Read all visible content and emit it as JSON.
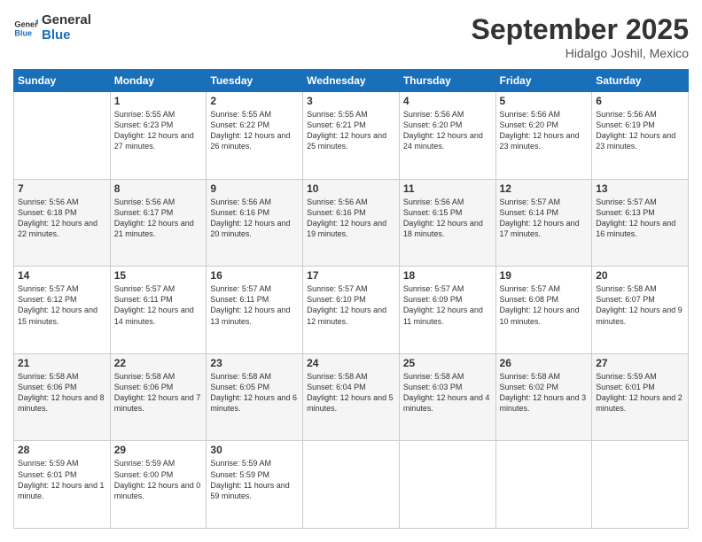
{
  "header": {
    "logo_general": "General",
    "logo_blue": "Blue",
    "month_title": "September 2025",
    "location": "Hidalgo Joshil, Mexico"
  },
  "days_of_week": [
    "Sunday",
    "Monday",
    "Tuesday",
    "Wednesday",
    "Thursday",
    "Friday",
    "Saturday"
  ],
  "weeks": [
    [
      {
        "day": "",
        "sunrise": "",
        "sunset": "",
        "daylight": ""
      },
      {
        "day": "1",
        "sunrise": "Sunrise: 5:55 AM",
        "sunset": "Sunset: 6:23 PM",
        "daylight": "Daylight: 12 hours and 27 minutes."
      },
      {
        "day": "2",
        "sunrise": "Sunrise: 5:55 AM",
        "sunset": "Sunset: 6:22 PM",
        "daylight": "Daylight: 12 hours and 26 minutes."
      },
      {
        "day": "3",
        "sunrise": "Sunrise: 5:55 AM",
        "sunset": "Sunset: 6:21 PM",
        "daylight": "Daylight: 12 hours and 25 minutes."
      },
      {
        "day": "4",
        "sunrise": "Sunrise: 5:56 AM",
        "sunset": "Sunset: 6:20 PM",
        "daylight": "Daylight: 12 hours and 24 minutes."
      },
      {
        "day": "5",
        "sunrise": "Sunrise: 5:56 AM",
        "sunset": "Sunset: 6:20 PM",
        "daylight": "Daylight: 12 hours and 23 minutes."
      },
      {
        "day": "6",
        "sunrise": "Sunrise: 5:56 AM",
        "sunset": "Sunset: 6:19 PM",
        "daylight": "Daylight: 12 hours and 23 minutes."
      }
    ],
    [
      {
        "day": "7",
        "sunrise": "Sunrise: 5:56 AM",
        "sunset": "Sunset: 6:18 PM",
        "daylight": "Daylight: 12 hours and 22 minutes."
      },
      {
        "day": "8",
        "sunrise": "Sunrise: 5:56 AM",
        "sunset": "Sunset: 6:17 PM",
        "daylight": "Daylight: 12 hours and 21 minutes."
      },
      {
        "day": "9",
        "sunrise": "Sunrise: 5:56 AM",
        "sunset": "Sunset: 6:16 PM",
        "daylight": "Daylight: 12 hours and 20 minutes."
      },
      {
        "day": "10",
        "sunrise": "Sunrise: 5:56 AM",
        "sunset": "Sunset: 6:16 PM",
        "daylight": "Daylight: 12 hours and 19 minutes."
      },
      {
        "day": "11",
        "sunrise": "Sunrise: 5:56 AM",
        "sunset": "Sunset: 6:15 PM",
        "daylight": "Daylight: 12 hours and 18 minutes."
      },
      {
        "day": "12",
        "sunrise": "Sunrise: 5:57 AM",
        "sunset": "Sunset: 6:14 PM",
        "daylight": "Daylight: 12 hours and 17 minutes."
      },
      {
        "day": "13",
        "sunrise": "Sunrise: 5:57 AM",
        "sunset": "Sunset: 6:13 PM",
        "daylight": "Daylight: 12 hours and 16 minutes."
      }
    ],
    [
      {
        "day": "14",
        "sunrise": "Sunrise: 5:57 AM",
        "sunset": "Sunset: 6:12 PM",
        "daylight": "Daylight: 12 hours and 15 minutes."
      },
      {
        "day": "15",
        "sunrise": "Sunrise: 5:57 AM",
        "sunset": "Sunset: 6:11 PM",
        "daylight": "Daylight: 12 hours and 14 minutes."
      },
      {
        "day": "16",
        "sunrise": "Sunrise: 5:57 AM",
        "sunset": "Sunset: 6:11 PM",
        "daylight": "Daylight: 12 hours and 13 minutes."
      },
      {
        "day": "17",
        "sunrise": "Sunrise: 5:57 AM",
        "sunset": "Sunset: 6:10 PM",
        "daylight": "Daylight: 12 hours and 12 minutes."
      },
      {
        "day": "18",
        "sunrise": "Sunrise: 5:57 AM",
        "sunset": "Sunset: 6:09 PM",
        "daylight": "Daylight: 12 hours and 11 minutes."
      },
      {
        "day": "19",
        "sunrise": "Sunrise: 5:57 AM",
        "sunset": "Sunset: 6:08 PM",
        "daylight": "Daylight: 12 hours and 10 minutes."
      },
      {
        "day": "20",
        "sunrise": "Sunrise: 5:58 AM",
        "sunset": "Sunset: 6:07 PM",
        "daylight": "Daylight: 12 hours and 9 minutes."
      }
    ],
    [
      {
        "day": "21",
        "sunrise": "Sunrise: 5:58 AM",
        "sunset": "Sunset: 6:06 PM",
        "daylight": "Daylight: 12 hours and 8 minutes."
      },
      {
        "day": "22",
        "sunrise": "Sunrise: 5:58 AM",
        "sunset": "Sunset: 6:06 PM",
        "daylight": "Daylight: 12 hours and 7 minutes."
      },
      {
        "day": "23",
        "sunrise": "Sunrise: 5:58 AM",
        "sunset": "Sunset: 6:05 PM",
        "daylight": "Daylight: 12 hours and 6 minutes."
      },
      {
        "day": "24",
        "sunrise": "Sunrise: 5:58 AM",
        "sunset": "Sunset: 6:04 PM",
        "daylight": "Daylight: 12 hours and 5 minutes."
      },
      {
        "day": "25",
        "sunrise": "Sunrise: 5:58 AM",
        "sunset": "Sunset: 6:03 PM",
        "daylight": "Daylight: 12 hours and 4 minutes."
      },
      {
        "day": "26",
        "sunrise": "Sunrise: 5:58 AM",
        "sunset": "Sunset: 6:02 PM",
        "daylight": "Daylight: 12 hours and 3 minutes."
      },
      {
        "day": "27",
        "sunrise": "Sunrise: 5:59 AM",
        "sunset": "Sunset: 6:01 PM",
        "daylight": "Daylight: 12 hours and 2 minutes."
      }
    ],
    [
      {
        "day": "28",
        "sunrise": "Sunrise: 5:59 AM",
        "sunset": "Sunset: 6:01 PM",
        "daylight": "Daylight: 12 hours and 1 minute."
      },
      {
        "day": "29",
        "sunrise": "Sunrise: 5:59 AM",
        "sunset": "Sunset: 6:00 PM",
        "daylight": "Daylight: 12 hours and 0 minutes."
      },
      {
        "day": "30",
        "sunrise": "Sunrise: 5:59 AM",
        "sunset": "Sunset: 5:59 PM",
        "daylight": "Daylight: 11 hours and 59 minutes."
      },
      {
        "day": "",
        "sunrise": "",
        "sunset": "",
        "daylight": ""
      },
      {
        "day": "",
        "sunrise": "",
        "sunset": "",
        "daylight": ""
      },
      {
        "day": "",
        "sunrise": "",
        "sunset": "",
        "daylight": ""
      },
      {
        "day": "",
        "sunrise": "",
        "sunset": "",
        "daylight": ""
      }
    ]
  ]
}
